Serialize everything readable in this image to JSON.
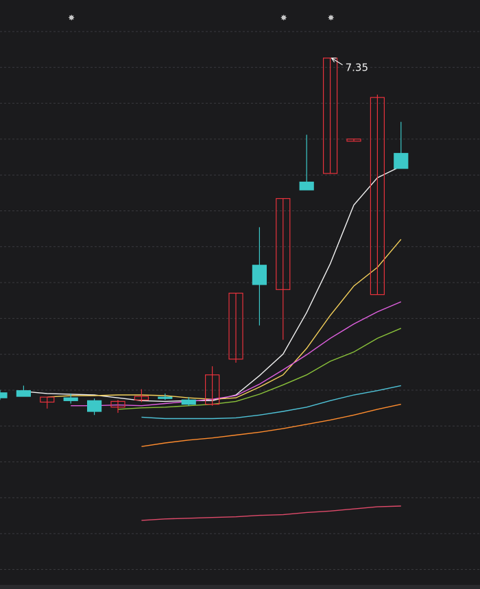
{
  "colors": {
    "background": "#1b1b1d",
    "grid": "#3a3a3e",
    "up": "#e8323c",
    "down": "#3cc8c8",
    "annotation": "#f2f2f2",
    "marker": "#c8c8c8"
  },
  "chart_data": {
    "type": "candlestick",
    "title": "",
    "xlabel": "",
    "ylabel": "",
    "ylim": [
      0.0,
      8.16
    ],
    "grid": true,
    "legend": "none",
    "max_label": "7.35",
    "marker_symbol": "✸",
    "markers_at_candle": [
      3,
      12,
      14
    ],
    "candles": [
      {
        "o": 2.68,
        "h": 2.72,
        "l": 2.58,
        "c": 2.61
      },
      {
        "o": 2.71,
        "h": 2.78,
        "l": 2.63,
        "c": 2.63
      },
      {
        "o": 2.55,
        "h": 2.59,
        "l": 2.46,
        "c": 2.62
      },
      {
        "o": 2.61,
        "h": 2.67,
        "l": 2.53,
        "c": 2.57
      },
      {
        "o": 2.57,
        "h": 2.6,
        "l": 2.37,
        "c": 2.42
      },
      {
        "o": 2.48,
        "h": 2.58,
        "l": 2.4,
        "c": 2.56
      },
      {
        "o": 2.58,
        "h": 2.73,
        "l": 2.55,
        "c": 2.63
      },
      {
        "o": 2.62,
        "h": 2.67,
        "l": 2.58,
        "c": 2.6
      },
      {
        "o": 2.58,
        "h": 2.62,
        "l": 2.5,
        "c": 2.52
      },
      {
        "o": 2.52,
        "h": 3.05,
        "l": 2.5,
        "c": 2.93
      },
      {
        "o": 3.15,
        "h": 4.07,
        "l": 3.1,
        "c": 4.07
      },
      {
        "o": 4.46,
        "h": 4.99,
        "l": 3.62,
        "c": 4.19
      },
      {
        "o": 4.12,
        "h": 4.96,
        "l": 3.42,
        "c": 5.39
      },
      {
        "o": 5.62,
        "h": 6.28,
        "l": 5.52,
        "c": 5.51
      },
      {
        "o": 5.74,
        "h": 6.42,
        "l": 6.5,
        "c": 7.35
      },
      {
        "o": 6.19,
        "h": 6.19,
        "l": 6.21,
        "c": 6.22
      },
      {
        "o": 4.05,
        "h": 6.84,
        "l": 6.79,
        "c": 6.8
      },
      {
        "o": 6.02,
        "h": 6.46,
        "l": 6.7,
        "c": 5.81
      }
    ],
    "ma": [
      {
        "color": "#f2f2f2",
        "values": [
          2.7,
          2.67,
          2.66,
          2.65,
          2.61,
          2.57,
          2.56,
          2.57,
          2.57,
          2.65,
          2.92,
          3.22,
          3.8,
          4.48,
          5.3,
          5.68,
          5.84
        ]
      },
      {
        "color": "#f5d15b",
        "values": [
          2.62,
          2.64,
          2.64,
          2.65,
          2.65,
          2.64,
          2.61,
          2.59,
          2.61,
          2.76,
          2.93,
          3.3,
          3.76,
          4.17,
          4.43,
          4.82
        ]
      },
      {
        "color": "#e060e0",
        "values": [
          2.5,
          2.5,
          2.51,
          2.5,
          2.53,
          2.56,
          2.59,
          2.64,
          2.8,
          3.0,
          3.21,
          3.44,
          3.64,
          3.81,
          3.95
        ]
      },
      {
        "color": "#8ac23a",
        "values": [
          2.45,
          2.47,
          2.48,
          2.5,
          2.52,
          2.56,
          2.66,
          2.79,
          2.93,
          3.12,
          3.25,
          3.44,
          3.58
        ]
      },
      {
        "color": "#4fc3d8",
        "values": [
          2.34,
          2.32,
          2.32,
          2.32,
          2.33,
          2.37,
          2.42,
          2.48,
          2.57,
          2.65,
          2.71,
          2.78
        ]
      },
      {
        "color": "#ff8c2e",
        "values": [
          1.93,
          1.98,
          2.02,
          2.05,
          2.09,
          2.13,
          2.18,
          2.24,
          2.3,
          2.37,
          2.45,
          2.52
        ]
      },
      {
        "color": "#e04a6a",
        "values": [
          0.9,
          0.92,
          0.93,
          0.94,
          0.95,
          0.97,
          0.98,
          1.01,
          1.03,
          1.06,
          1.09,
          1.1
        ]
      }
    ]
  }
}
